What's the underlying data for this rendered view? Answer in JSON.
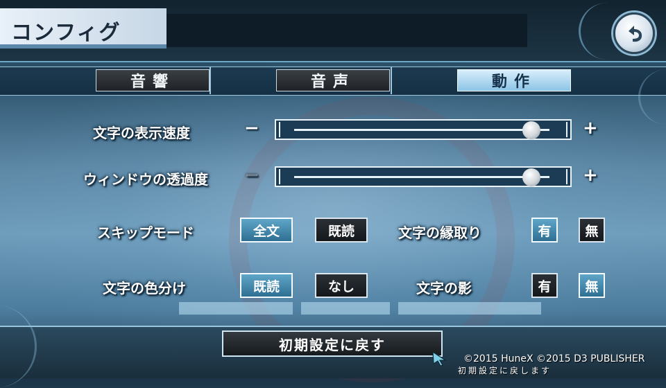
{
  "header": {
    "title": "コンフィグ",
    "back_icon": "return-arrow-icon"
  },
  "tabs": [
    {
      "label": "音響",
      "active": false
    },
    {
      "label": "音声",
      "active": false
    },
    {
      "label": "動作",
      "active": true
    }
  ],
  "settings": {
    "text_speed": {
      "label": "文字の表示速度",
      "minus": "−",
      "plus": "+",
      "value_fraction": 0.93
    },
    "window_opacity": {
      "label": "ウィンドウの透過度",
      "minus": "−",
      "plus": "+",
      "value_fraction": 0.93
    },
    "skip_mode": {
      "label": "スキップモード",
      "options": [
        "全文",
        "既読"
      ],
      "selected": "全文"
    },
    "text_color": {
      "label": "文字の色分け",
      "options": [
        "既読",
        "なし"
      ],
      "selected": "既読"
    },
    "text_outline": {
      "label": "文字の縁取り",
      "options": [
        "有",
        "無"
      ],
      "selected": "有"
    },
    "text_shadow": {
      "label": "文字の影",
      "options": [
        "有",
        "無"
      ],
      "selected": "無"
    }
  },
  "footer": {
    "reset_label": "初期設定に戻す",
    "copyright": "©2015 HuneX ©2015 D3 PUBLISHER",
    "hint": "初期設定に戻します"
  },
  "colors": {
    "accent": "#8cc4e6",
    "selected": "#2e6f92",
    "panel": "#1b3c54"
  }
}
